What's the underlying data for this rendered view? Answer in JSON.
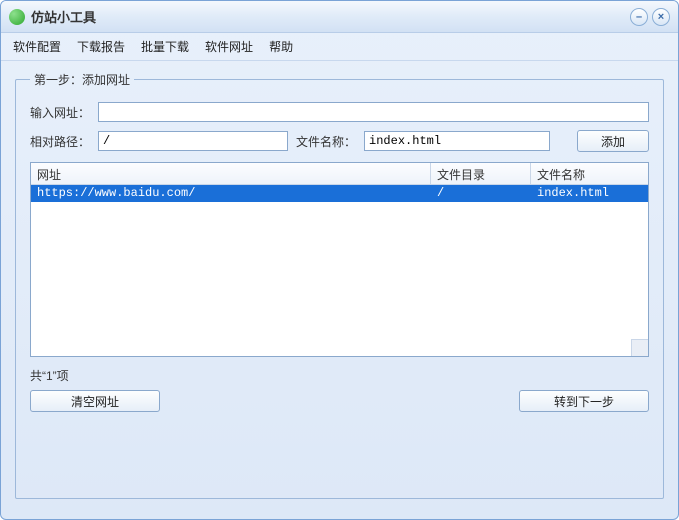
{
  "window": {
    "title": "仿站小工具"
  },
  "menu": {
    "items": [
      "软件配置",
      "下载报告",
      "批量下载",
      "软件网址",
      "帮助"
    ]
  },
  "group": {
    "legend": "第一步：添加网址",
    "input_url_label": "输入网址：",
    "input_url_value": "",
    "rel_path_label": "相对路径：",
    "rel_path_value": "/",
    "filename_label": "文件名称：",
    "filename_value": "index.html",
    "add_btn": "添加",
    "table": {
      "headers": [
        "网址",
        "文件目录",
        "文件名称"
      ],
      "rows": [
        {
          "url": "https://www.baidu.com/",
          "dir": "/",
          "file": "index.html",
          "selected": true
        }
      ]
    },
    "status": "共“1”项",
    "clear_btn": "清空网址",
    "next_btn": "转到下一步"
  },
  "controls": {
    "minimize": "–",
    "close": "×"
  }
}
